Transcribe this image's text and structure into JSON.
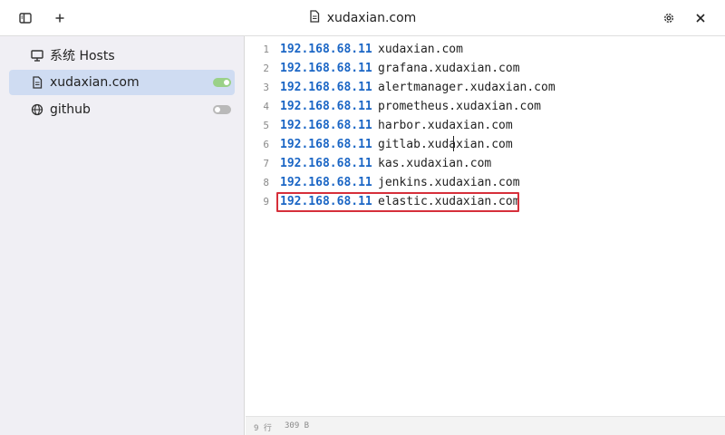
{
  "window": {
    "title": "xudaxian.com",
    "icons": {
      "toggle_sidebar": "sidebar-panel-icon",
      "add": "plus-icon",
      "title": "file-icon",
      "settings": "gear-icon",
      "close": "close-icon"
    }
  },
  "sidebar": {
    "items": [
      {
        "label": "系统 Hosts",
        "icon": "monitor-icon",
        "active": false,
        "toggle": null
      },
      {
        "label": "xudaxian.com",
        "icon": "file-icon",
        "active": true,
        "toggle": "on"
      },
      {
        "label": "github",
        "icon": "globe-icon",
        "active": false,
        "toggle": "off"
      }
    ]
  },
  "editor": {
    "lines": [
      {
        "num": "1",
        "ip": "192.168.68.11",
        "host": "xudaxian.com"
      },
      {
        "num": "2",
        "ip": "192.168.68.11",
        "host": "grafana.xudaxian.com"
      },
      {
        "num": "3",
        "ip": "192.168.68.11",
        "host": "alertmanager.xudaxian.com"
      },
      {
        "num": "4",
        "ip": "192.168.68.11",
        "host": "prometheus.xudaxian.com"
      },
      {
        "num": "5",
        "ip": "192.168.68.11",
        "host": "harbor.xudaxian.com"
      },
      {
        "num": "6",
        "ip": "192.168.68.11",
        "host": "gitlab.xudaxian.com"
      },
      {
        "num": "7",
        "ip": "192.168.68.11",
        "host": "kas.xudaxian.com"
      },
      {
        "num": "8",
        "ip": "192.168.68.11",
        "host": "jenkins.xudaxian.com"
      },
      {
        "num": "9",
        "ip": "192.168.68.11",
        "host": "elastic.xudaxian.com"
      }
    ],
    "highlighted_line": 9
  },
  "status": {
    "lines": "9 行",
    "size": "309 B"
  },
  "colors": {
    "ip": "#1b66c5",
    "highlight_border": "#d62f3a",
    "toggle_on": "#9ad188",
    "toggle_off": "#b9b9b9",
    "sidebar_active": "#cfdcf2"
  }
}
